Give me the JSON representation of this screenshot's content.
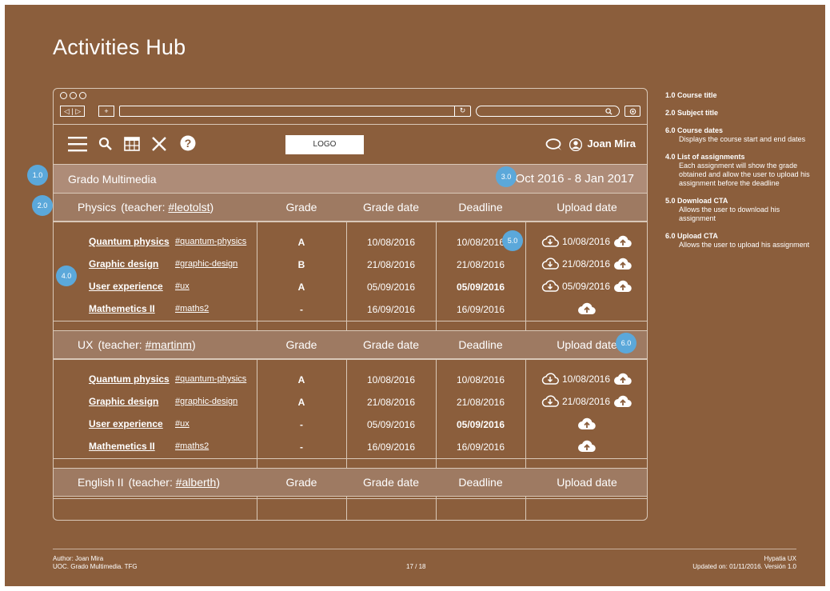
{
  "page_title": "Activities Hub",
  "browser": {
    "nav": "◁ | ▷",
    "new_tab": "+",
    "reload": "↻",
    "search_icon": "search-icon",
    "settings_icon": "gear-icon"
  },
  "toolbar": {
    "logo": "LOGO",
    "user_name": "Joan Mira"
  },
  "course": {
    "title": "Grado Multimedia",
    "dates": "1 Oct 2016 - 8 Jan 2017"
  },
  "columns": {
    "grade": "Grade",
    "grade_date": "Grade date",
    "deadline": "Deadline",
    "upload_date": "Upload date"
  },
  "subjects": [
    {
      "name": "Physics",
      "teacher_prefix": "(teacher: ",
      "teacher": "#leotolst",
      "teacher_suffix": ")",
      "rows": [
        {
          "name": "Quantum physics",
          "tag": "#quantum-physics",
          "grade": "A",
          "grade_date": "10/08/2016",
          "deadline": "10/08/2016",
          "upload": "10/08/2016"
        },
        {
          "name": "Graphic design",
          "tag": "#graphic-design",
          "grade": "B",
          "grade_date": "21/08/2016",
          "deadline": "21/08/2016",
          "upload": "21/08/2016"
        },
        {
          "name": "User experience",
          "tag": "#ux",
          "grade": "A",
          "grade_date": "05/09/2016",
          "deadline": "05/09/2016",
          "upload": "05/09/2016"
        },
        {
          "name": "Mathemetics II",
          "tag": "#maths2",
          "grade": "-",
          "grade_date": "16/09/2016",
          "deadline": "16/09/2016",
          "upload": ""
        }
      ]
    },
    {
      "name": "UX",
      "teacher_prefix": "(teacher: ",
      "teacher": "#martinm",
      "teacher_suffix": ")",
      "rows": [
        {
          "name": "Quantum physics",
          "tag": "#quantum-physics",
          "grade": "A",
          "grade_date": "10/08/2016",
          "deadline": "10/08/2016",
          "upload": "10/08/2016"
        },
        {
          "name": "Graphic design",
          "tag": "#graphic-design",
          "grade": "A",
          "grade_date": "21/08/2016",
          "deadline": "21/08/2016",
          "upload": "21/08/2016"
        },
        {
          "name": "User experience",
          "tag": "#ux",
          "grade": "-",
          "grade_date": "05/09/2016",
          "deadline": "05/09/2016",
          "upload": ""
        },
        {
          "name": "Mathemetics II",
          "tag": "#maths2",
          "grade": "-",
          "grade_date": "16/09/2016",
          "deadline": "16/09/2016",
          "upload": ""
        }
      ]
    },
    {
      "name": "English II",
      "teacher_prefix": "(teacher: ",
      "teacher": "#alberth",
      "teacher_suffix": ")",
      "rows": []
    }
  ],
  "markers": [
    "1.0",
    "2.0",
    "3.0",
    "4.0",
    "5.0",
    "6.0"
  ],
  "notes": [
    {
      "title": "1.0  Course title",
      "desc": ""
    },
    {
      "title": "2.0  Subject title",
      "desc": ""
    },
    {
      "title": "6.0  Course dates",
      "desc": "Displays the course start and end dates"
    },
    {
      "title": "4.0  List of assignments",
      "desc": "Each assignment will show the grade obtained  and allow the user to upload his assignment before the deadline"
    },
    {
      "title": "5.0  Download CTA",
      "desc": "Allows the user to download his assignment"
    },
    {
      "title": "6.0  Upload CTA",
      "desc": "Allows the user to upload his assignment"
    }
  ],
  "footer": {
    "author": "Author: Joan Mira",
    "school": "UOC. Grado Multimedia. TFG",
    "page": "17 / 18",
    "brand": "Hypatia UX",
    "updated": "Updated on: 01/11/2016. Versión 1.0"
  },
  "colors": {
    "background": "#8B5E3C",
    "course_row": "#AE8C78",
    "subject_row": "#9E7A62",
    "marker": "#5BA8DA"
  }
}
